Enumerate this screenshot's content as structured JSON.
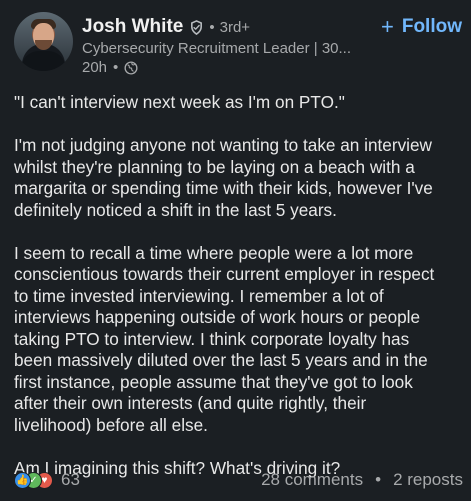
{
  "author": {
    "name": "Josh White",
    "degree": "3rd+",
    "headline": "Cybersecurity Recruitment Leader | 30...",
    "time": "20h",
    "visibility_icon": "globe-icon",
    "verified_icon": "verified-badge-icon"
  },
  "actions": {
    "follow_label": "Follow",
    "follow_icon": "plus-icon"
  },
  "body": {
    "paragraphs": [
      "\"I can't interview next week as I'm on PTO.\"",
      "I'm not judging anyone not wanting to take an interview\nwhilst they're planning to be laying on a beach with a\nmargarita or spending time with their kids, however I've\ndefinitely noticed a shift in the last 5 years.",
      "I seem to recall a time where people were a lot more\nconscientious towards their current employer in respect\nto time invested interviewing. I remember a lot of\ninterviews happening outside of work hours or people\ntaking PTO to interview. I think corporate loyalty has\nbeen massively diluted over the last 5 years and in the\nfirst instance, people assume that they've got to look\nafter their own interests (and quite rightly, their\nlivelihood) before all else.",
      "Am I imagining this shift? What's driving it?"
    ]
  },
  "social": {
    "reaction_count": "63",
    "comments": "28 comments",
    "reposts": "2 reposts",
    "separator": "•",
    "reaction_icons": [
      "like-icon",
      "celebrate-icon",
      "love-icon"
    ]
  },
  "colors": {
    "background": "#1b1f23",
    "accent": "#71b7fb",
    "muted": "#a7a9ab",
    "text": "#e8e8e8"
  }
}
